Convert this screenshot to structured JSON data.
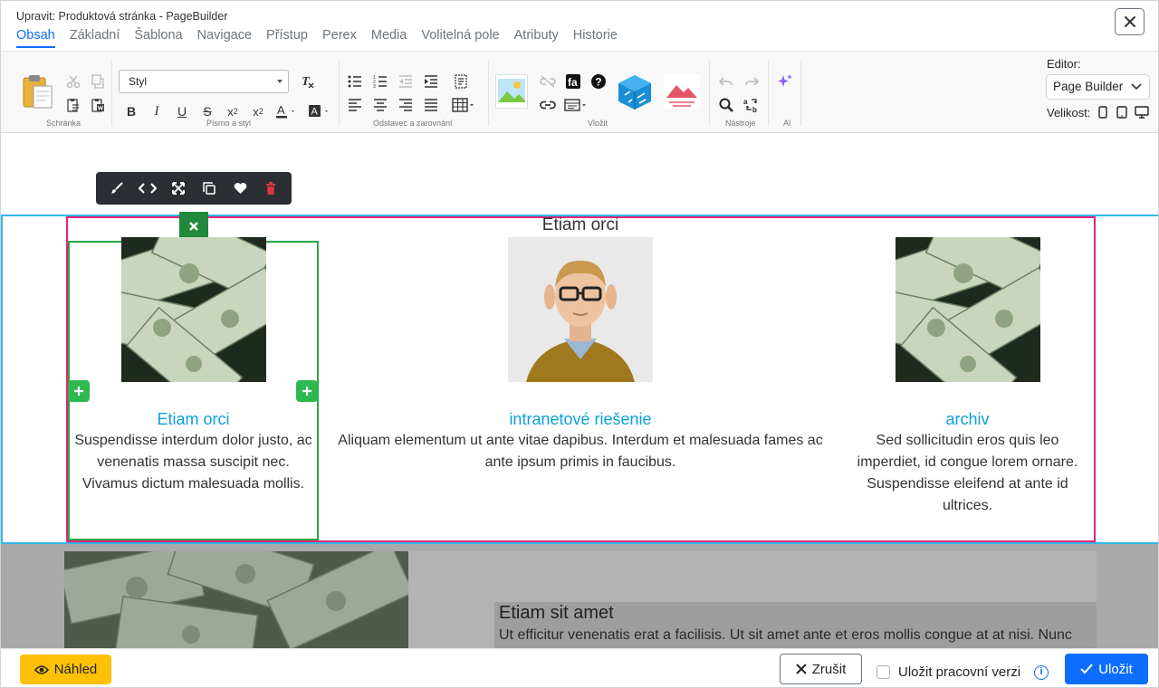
{
  "window": {
    "title": "Upravit: Produktová stránka - PageBuilder"
  },
  "tabs": [
    {
      "label": "Obsah",
      "active": true
    },
    {
      "label": "Základní"
    },
    {
      "label": "Šablona"
    },
    {
      "label": "Navigace"
    },
    {
      "label": "Přístup"
    },
    {
      "label": "Perex"
    },
    {
      "label": "Media"
    },
    {
      "label": "Volitelná pole"
    },
    {
      "label": "Atributy"
    },
    {
      "label": "Historie"
    }
  ],
  "toolbar": {
    "style_select": "Styl",
    "groups": {
      "clipboard": "Schránka",
      "font": "Písmo a styl",
      "paragraph": "Odstavec a zarovnání",
      "insert": "Vložit",
      "tools": "Nástroje",
      "ai": "AI"
    },
    "editor_label": "Editor:",
    "editor_value": "Page Builder",
    "size_label": "Velikost:"
  },
  "canvas": {
    "section_title": "Etiam orci",
    "cards": [
      {
        "title": "Etiam orci",
        "text": [
          "Suspendisse interdum dolor justo, ac",
          "venenatis massa suscipit nec.",
          "Vivamus dictum malesuada mollis."
        ]
      },
      {
        "title": "intranetové riešenie",
        "text": [
          "Aliquam elementum ut ante vitae dapibus. Interdum et malesuada fames ac",
          "ante ipsum primis in faucibus."
        ]
      },
      {
        "title": "archiv",
        "text": [
          "Sed sollicitudin eros quis leo",
          "imperdiet, id congue lorem ornare.",
          "Suspendisse eleifend at ante id",
          "ultrices."
        ]
      }
    ],
    "lower": {
      "title": "Etiam sit amet",
      "text": "Ut efficitur venenatis erat a facilisis. Ut sit amet ante et eros mollis congue at at nisi. Nunc"
    }
  },
  "footer": {
    "preview": "Náhled",
    "cancel": "Zrušit",
    "save_draft": "Uložit pracovní verzi",
    "save": "Uložit"
  },
  "colors": {
    "accent": "#0d6efd",
    "preview_button": "#ffc107",
    "section_outline": "#33b5e5",
    "row_outline": "#e0247b",
    "column_outline": "#28a745",
    "card_title": "#0da0d8"
  }
}
